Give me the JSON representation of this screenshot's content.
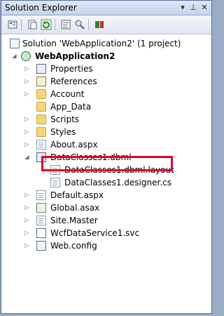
{
  "title": "Solution Explorer",
  "solution_label": "Solution 'WebApplication2' (1 project)",
  "project_label": "WebApplication2",
  "items": [
    {
      "label": "Properties"
    },
    {
      "label": "References"
    },
    {
      "label": "Account"
    },
    {
      "label": "App_Data"
    },
    {
      "label": "Scripts"
    },
    {
      "label": "Styles"
    },
    {
      "label": "About.aspx"
    },
    {
      "label": "DataClasses1.dbml"
    },
    {
      "label": "DataClasses1.dbml.layout"
    },
    {
      "label": "DataClasses1.designer.cs"
    },
    {
      "label": "Default.aspx"
    },
    {
      "label": "Global.asax"
    },
    {
      "label": "Site.Master"
    },
    {
      "label": "WcfDataService1.svc"
    },
    {
      "label": "Web.config"
    }
  ],
  "toolbar_icons": [
    "properties-icon",
    "show-all-files-icon",
    "refresh-icon",
    "view-code-icon",
    "view-designer-icon",
    "class-diagram-icon",
    "copy-website-icon"
  ],
  "colors": {
    "highlight": "#e0002a",
    "title_bg": "#c7d4ea",
    "folder": "#f4d77a"
  }
}
